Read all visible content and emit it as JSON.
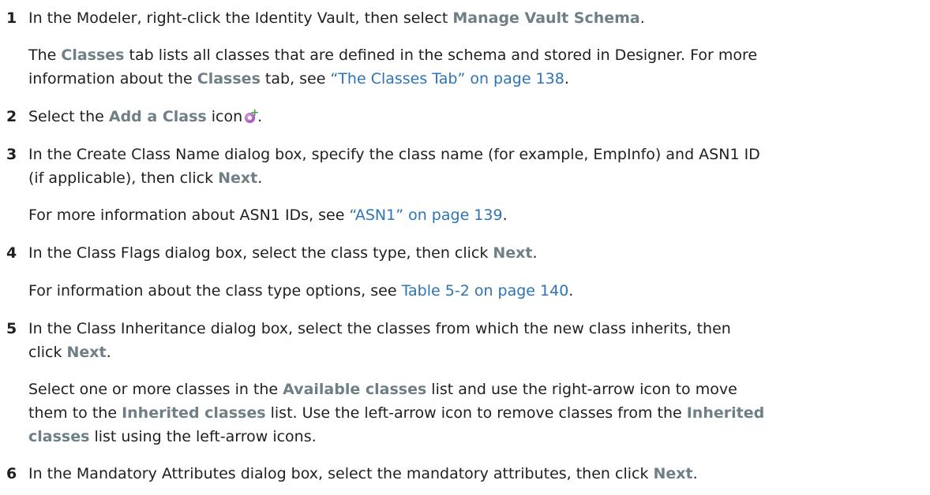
{
  "steps": [
    {
      "number": "1",
      "lines": [
        {
          "pre": "In the Modeler, right-click the Identity Vault, then select ",
          "ui": "Manage Vault Schema",
          "post": "."
        },
        {
          "pre": "The ",
          "ui": "Classes",
          "post": " tab lists all classes that are defined in the schema and stored in Designer. For more"
        },
        {
          "pre": "information about the ",
          "ui": "Classes",
          "mid": " tab, see ",
          "link": "“The Classes Tab” on page 138",
          "post": "."
        }
      ]
    },
    {
      "number": "2",
      "lines": [
        {
          "pre": "Select the ",
          "ui": "Add a Class",
          "post": " icon",
          "icon": "add-class-icon",
          "after": "."
        }
      ]
    },
    {
      "number": "3",
      "lines": [
        {
          "pre": "In the Create Class Name dialog box, specify the class name (for example, EmpInfo) and ASN1 ID"
        },
        {
          "pre": "(if applicable), then click ",
          "ui": "Next",
          "post": "."
        },
        {
          "pre": "For more information about ASN1 IDs, see ",
          "link": "“ASN1” on page 139",
          "post": "."
        }
      ]
    },
    {
      "number": "4",
      "lines": [
        {
          "pre": "In the Class Flags dialog box, select the class type, then click ",
          "ui": "Next",
          "post": "."
        },
        {
          "pre": "For information about the class type options, see ",
          "link": "Table 5-2 on page 140",
          "post": "."
        }
      ]
    },
    {
      "number": "5",
      "lines": [
        {
          "pre": "In the Class Inheritance dialog box, select the classes from which the new class inherits, then"
        },
        {
          "pre": "click ",
          "ui": "Next",
          "post": "."
        },
        {
          "pre": "Select one or more classes in the ",
          "ui": "Available classes",
          "post": " list and use the right-arrow icon to move"
        },
        {
          "pre": "them to the ",
          "ui": "Inherited classes",
          "mid": " list. Use the left-arrow icon to remove classes from the ",
          "ui2": "Inherited"
        },
        {
          "ui": "classes",
          "post": " list using the left-arrow icons."
        }
      ]
    },
    {
      "number": "6",
      "lines": [
        {
          "pre": "In the Mandatory Attributes dialog box, select the mandatory attributes, then click ",
          "ui": "Next",
          "post": "."
        }
      ]
    }
  ]
}
